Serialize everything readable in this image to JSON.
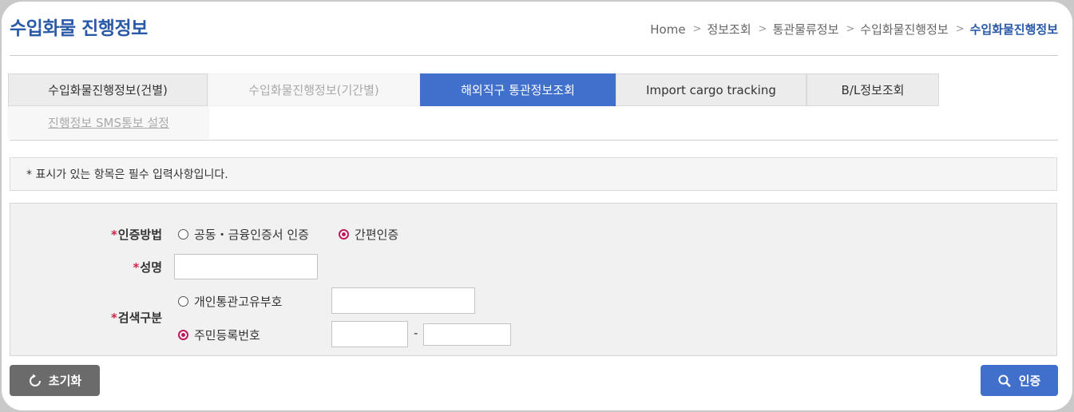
{
  "page": {
    "title": "수입화물 진행정보"
  },
  "breadcrumb": [
    "Home",
    "정보조회",
    "통관물류정보",
    "수입화물진행정보",
    "수입화물진행정보"
  ],
  "tabs": [
    {
      "label": "수입화물진행정보(건별)",
      "state": "normal"
    },
    {
      "label": "수입화물진행정보(기간별)",
      "state": "dim"
    },
    {
      "label": "해외직구 통관정보조회",
      "state": "active"
    },
    {
      "label": "Import cargo tracking",
      "state": "normal"
    },
    {
      "label": "B/L정보조회",
      "state": "normal"
    },
    {
      "label": "진행정보 SMS통보 설정",
      "state": "dim"
    }
  ],
  "notice": "* 표시가 있는 항목은 필수 입력사항입니다.",
  "form": {
    "required_mark": "*",
    "auth_method": {
      "label": "인증방법",
      "options": [
        "공동・금융인증서 인증",
        "간편인증"
      ],
      "selected": "간편인증"
    },
    "name": {
      "label": "성명",
      "value": ""
    },
    "search_type": {
      "label": "검색구분",
      "options": [
        "개인통관고유부호",
        "주민등록번호"
      ],
      "selected": "주민등록번호",
      "customs_code_value": "",
      "rrn_front": "",
      "rrn_back": "",
      "rrn_separator": "-"
    }
  },
  "buttons": {
    "reset": "초기화",
    "auth": "인증"
  },
  "colors": {
    "accent": "#4070cc",
    "title": "#2a59a8",
    "required": "#d0264a",
    "radio_selected": "#c0175c"
  },
  "icons": {
    "reset": "refresh-icon",
    "auth": "search-icon",
    "breadcrumb_separator": "chevron-right-icon"
  }
}
